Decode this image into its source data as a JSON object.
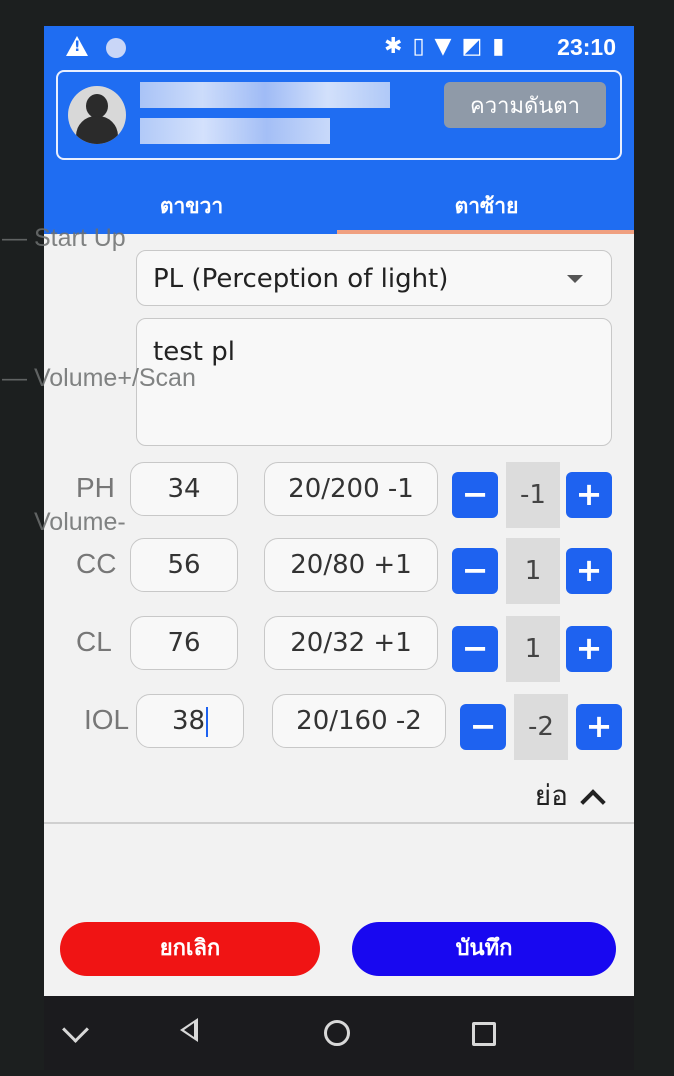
{
  "bezel": {
    "start_up": "Start Up",
    "volume_up": "Volume+/Scan",
    "volume_down": "Volume-"
  },
  "status_bar": {
    "time": "23:10",
    "icons": [
      "warning-icon",
      "circle-icon",
      "bluetooth-icon",
      "vibrate-icon",
      "wifi-icon",
      "no-sim-icon",
      "battery-icon"
    ]
  },
  "header": {
    "eye_pressure_button": "ความดันตา",
    "tabs": [
      {
        "label": "ตาขวา",
        "selected": false
      },
      {
        "label": "ตาซ้าย",
        "selected": true
      }
    ]
  },
  "form": {
    "vision_select": "PL (Perception of light)",
    "notes": "test pl",
    "rows": [
      {
        "label": "PH",
        "value": "34",
        "acuity": "20/200 -1",
        "step": "-1"
      },
      {
        "label": "CC",
        "value": "56",
        "acuity": "20/80 +1",
        "step": "1"
      },
      {
        "label": "CL",
        "value": "76",
        "acuity": "20/32 +1",
        "step": "1"
      },
      {
        "label": "IOL",
        "value": "38",
        "acuity": "20/160 -2",
        "step": "-2"
      }
    ],
    "collapse_label": "ย่อ"
  },
  "footer": {
    "cancel_label": "ยกเลิก",
    "save_label": "บันทึก"
  },
  "colors": {
    "header_blue": "#1f6df2",
    "cancel_red": "#f01414",
    "save_blue": "#1808f0"
  }
}
